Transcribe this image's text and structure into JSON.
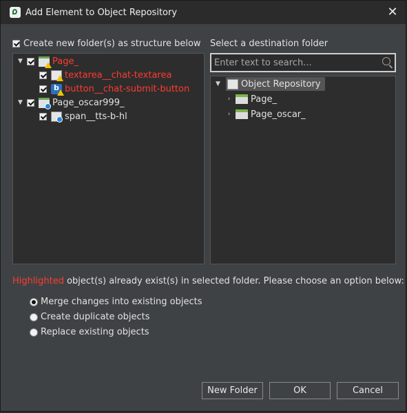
{
  "dialog": {
    "title": "Add Element to Object Repository",
    "close_glyph": "✕"
  },
  "left": {
    "create_folder_label": "Create new folder(s) as structure below",
    "create_folder_checked": true,
    "tree": [
      {
        "label": "Page_",
        "highlighted": true,
        "checked": true,
        "expanded": true,
        "icon": "page-warning-icon"
      },
      {
        "label": "textarea__chat-textarea",
        "highlighted": true,
        "checked": true,
        "icon": "textarea-warning-icon"
      },
      {
        "label": "button__chat-submit-button",
        "highlighted": true,
        "checked": true,
        "icon": "button-warning-icon"
      },
      {
        "label": "Page_oscar999_",
        "highlighted": false,
        "checked": true,
        "expanded": true,
        "icon": "page-info-icon"
      },
      {
        "label": "span__tts-b-hl",
        "highlighted": false,
        "checked": true,
        "icon": "span-element-icon"
      }
    ]
  },
  "right": {
    "header": "Select a destination folder",
    "search_placeholder": "Enter text to search...",
    "root_label": "Object Repository",
    "folders": [
      "Page_",
      "Page_oscar_"
    ]
  },
  "message": {
    "highlight_word": "Highlighted",
    "rest": " object(s) already exist(s) in selected folder. Please choose an option below:"
  },
  "options": [
    {
      "label": "Merge changes into existing objects",
      "selected": true
    },
    {
      "label": "Create duplicate objects",
      "selected": false
    },
    {
      "label": "Replace existing objects",
      "selected": false
    }
  ],
  "buttons": {
    "new_folder": "New Folder",
    "ok": "OK",
    "cancel": "Cancel"
  },
  "colors": {
    "highlight": "#ff3b30",
    "dialog_bg": "#3f4245",
    "panel_bg": "#2d2d2d"
  }
}
